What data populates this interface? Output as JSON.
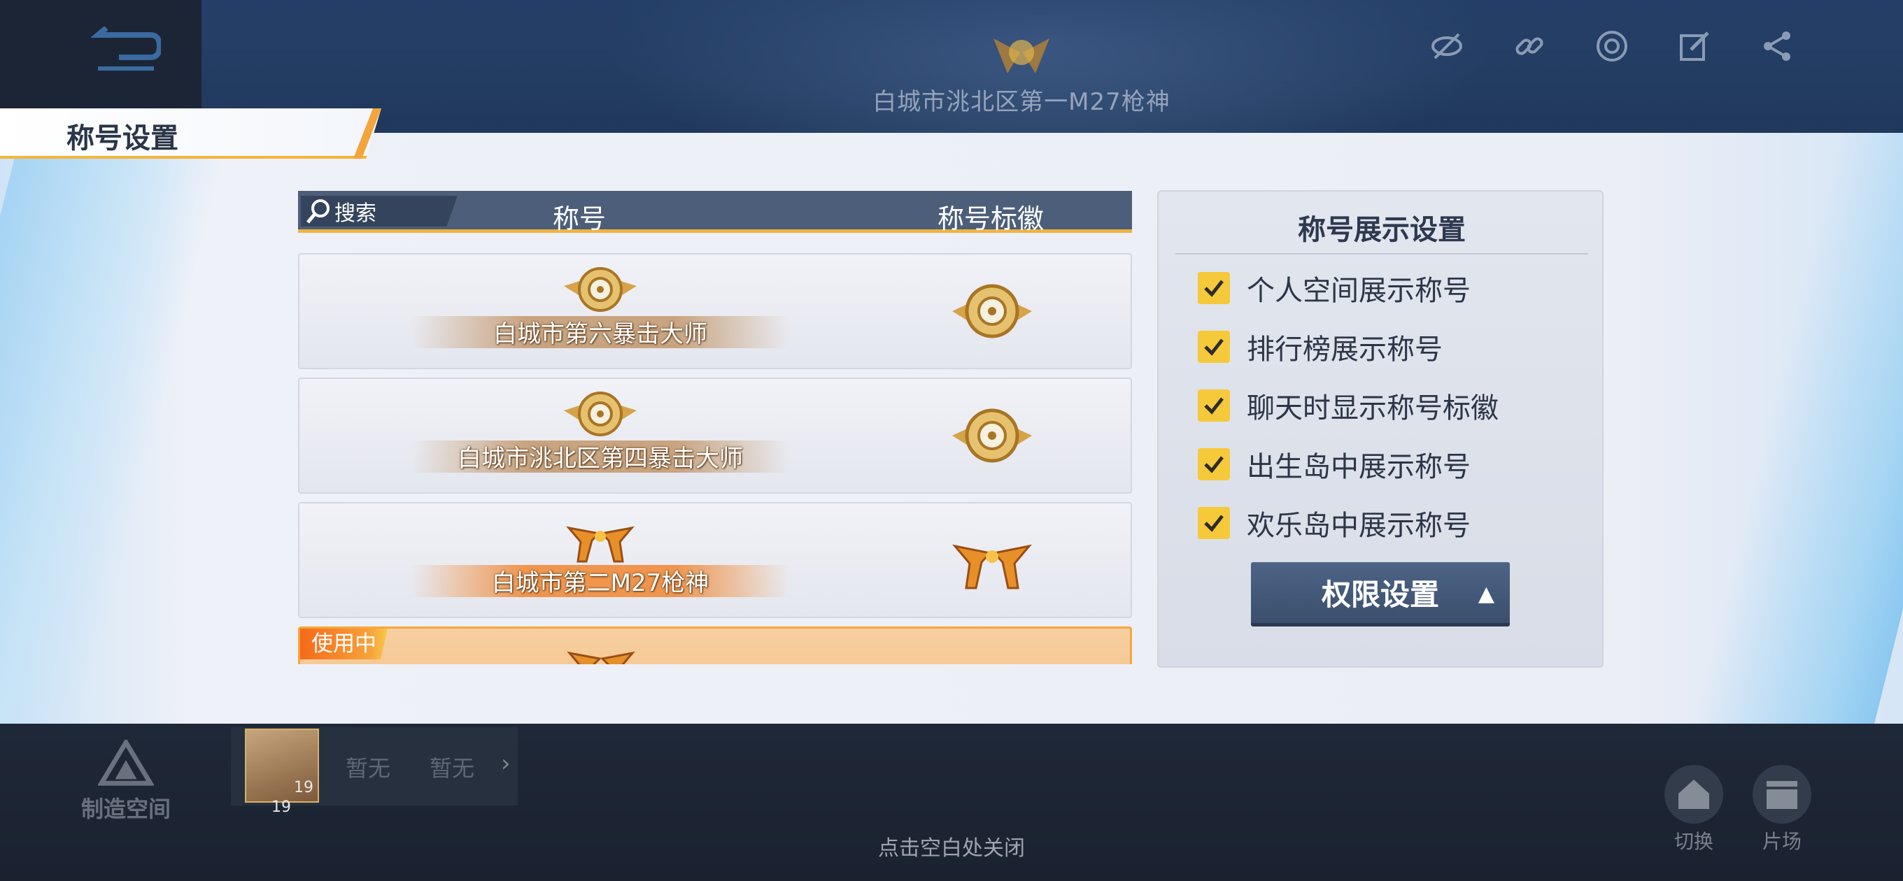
{
  "top": {
    "current_title": "白城市洮北区第一M27枪神",
    "icons": [
      "eye-off-icon",
      "link-icon",
      "swirl-icon",
      "edit-icon",
      "share-icon"
    ]
  },
  "panel": {
    "title": "称号设置"
  },
  "list": {
    "search_label": "搜索",
    "col_title": "称号",
    "col_emblem": "称号标徽",
    "rows": [
      {
        "name": "白城市第六暴击大师",
        "badge": "crosshair-gold"
      },
      {
        "name": "白城市洮北区第四暴击大师",
        "badge": "crosshair-gold"
      },
      {
        "name": "白城市第二M27枪神",
        "badge": "twin-guns-gold"
      },
      {
        "name": "",
        "badge": "twin-guns-gold",
        "status": "使用中"
      }
    ]
  },
  "settings": {
    "title": "称号展示设置",
    "options": [
      {
        "label": "个人空间展示称号",
        "checked": true
      },
      {
        "label": "排行榜展示称号",
        "checked": true
      },
      {
        "label": "聊天时显示称号标徽",
        "checked": true
      },
      {
        "label": "出生岛中展示称号",
        "checked": true
      },
      {
        "label": "欢乐岛中展示称号",
        "checked": true
      }
    ],
    "permission_button": "权限设置"
  },
  "bottom": {
    "maker_space": "制造空间",
    "avatar_level": "19",
    "avatar_num": "19",
    "none_1": "暂无",
    "none_2": "暂无",
    "close_hint": "点击空白处关闭",
    "switch_label": "切换",
    "studio_label": "片场"
  },
  "colors": {
    "accent": "#f6b43a",
    "header": "#4c5e7a",
    "checkbox": "#f6c93a"
  }
}
